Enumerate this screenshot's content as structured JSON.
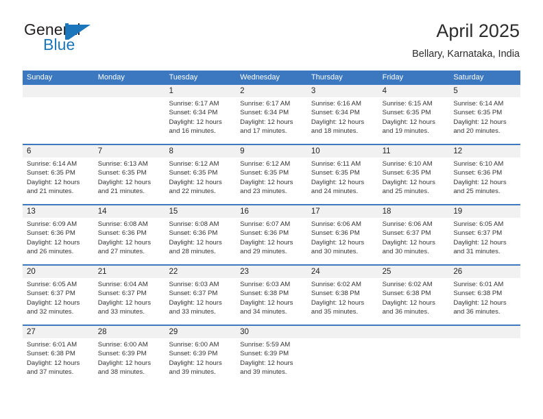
{
  "logo": {
    "word_top": "General",
    "word_bottom": "Blue",
    "mark": "triangle-flag-icon",
    "color": "#1b76bc"
  },
  "header": {
    "title": "April 2025",
    "subtitle": "Bellary, Karnataka, India"
  },
  "colors": {
    "header_blue": "#3b78c0",
    "row_band": "#f1f1f1",
    "text": "#333333"
  },
  "calendar": {
    "weekdays": [
      "Sunday",
      "Monday",
      "Tuesday",
      "Wednesday",
      "Thursday",
      "Friday",
      "Saturday"
    ],
    "weeks": [
      {
        "days": [
          {
            "num": "",
            "sunrise": "",
            "sunset": "",
            "daylight_1": "",
            "daylight_2": ""
          },
          {
            "num": "",
            "sunrise": "",
            "sunset": "",
            "daylight_1": "",
            "daylight_2": ""
          },
          {
            "num": "1",
            "sunrise": "Sunrise: 6:17 AM",
            "sunset": "Sunset: 6:34 PM",
            "daylight_1": "Daylight: 12 hours",
            "daylight_2": "and 16 minutes."
          },
          {
            "num": "2",
            "sunrise": "Sunrise: 6:17 AM",
            "sunset": "Sunset: 6:34 PM",
            "daylight_1": "Daylight: 12 hours",
            "daylight_2": "and 17 minutes."
          },
          {
            "num": "3",
            "sunrise": "Sunrise: 6:16 AM",
            "sunset": "Sunset: 6:34 PM",
            "daylight_1": "Daylight: 12 hours",
            "daylight_2": "and 18 minutes."
          },
          {
            "num": "4",
            "sunrise": "Sunrise: 6:15 AM",
            "sunset": "Sunset: 6:35 PM",
            "daylight_1": "Daylight: 12 hours",
            "daylight_2": "and 19 minutes."
          },
          {
            "num": "5",
            "sunrise": "Sunrise: 6:14 AM",
            "sunset": "Sunset: 6:35 PM",
            "daylight_1": "Daylight: 12 hours",
            "daylight_2": "and 20 minutes."
          }
        ]
      },
      {
        "days": [
          {
            "num": "6",
            "sunrise": "Sunrise: 6:14 AM",
            "sunset": "Sunset: 6:35 PM",
            "daylight_1": "Daylight: 12 hours",
            "daylight_2": "and 21 minutes."
          },
          {
            "num": "7",
            "sunrise": "Sunrise: 6:13 AM",
            "sunset": "Sunset: 6:35 PM",
            "daylight_1": "Daylight: 12 hours",
            "daylight_2": "and 21 minutes."
          },
          {
            "num": "8",
            "sunrise": "Sunrise: 6:12 AM",
            "sunset": "Sunset: 6:35 PM",
            "daylight_1": "Daylight: 12 hours",
            "daylight_2": "and 22 minutes."
          },
          {
            "num": "9",
            "sunrise": "Sunrise: 6:12 AM",
            "sunset": "Sunset: 6:35 PM",
            "daylight_1": "Daylight: 12 hours",
            "daylight_2": "and 23 minutes."
          },
          {
            "num": "10",
            "sunrise": "Sunrise: 6:11 AM",
            "sunset": "Sunset: 6:35 PM",
            "daylight_1": "Daylight: 12 hours",
            "daylight_2": "and 24 minutes."
          },
          {
            "num": "11",
            "sunrise": "Sunrise: 6:10 AM",
            "sunset": "Sunset: 6:35 PM",
            "daylight_1": "Daylight: 12 hours",
            "daylight_2": "and 25 minutes."
          },
          {
            "num": "12",
            "sunrise": "Sunrise: 6:10 AM",
            "sunset": "Sunset: 6:36 PM",
            "daylight_1": "Daylight: 12 hours",
            "daylight_2": "and 25 minutes."
          }
        ]
      },
      {
        "days": [
          {
            "num": "13",
            "sunrise": "Sunrise: 6:09 AM",
            "sunset": "Sunset: 6:36 PM",
            "daylight_1": "Daylight: 12 hours",
            "daylight_2": "and 26 minutes."
          },
          {
            "num": "14",
            "sunrise": "Sunrise: 6:08 AM",
            "sunset": "Sunset: 6:36 PM",
            "daylight_1": "Daylight: 12 hours",
            "daylight_2": "and 27 minutes."
          },
          {
            "num": "15",
            "sunrise": "Sunrise: 6:08 AM",
            "sunset": "Sunset: 6:36 PM",
            "daylight_1": "Daylight: 12 hours",
            "daylight_2": "and 28 minutes."
          },
          {
            "num": "16",
            "sunrise": "Sunrise: 6:07 AM",
            "sunset": "Sunset: 6:36 PM",
            "daylight_1": "Daylight: 12 hours",
            "daylight_2": "and 29 minutes."
          },
          {
            "num": "17",
            "sunrise": "Sunrise: 6:06 AM",
            "sunset": "Sunset: 6:36 PM",
            "daylight_1": "Daylight: 12 hours",
            "daylight_2": "and 30 minutes."
          },
          {
            "num": "18",
            "sunrise": "Sunrise: 6:06 AM",
            "sunset": "Sunset: 6:37 PM",
            "daylight_1": "Daylight: 12 hours",
            "daylight_2": "and 30 minutes."
          },
          {
            "num": "19",
            "sunrise": "Sunrise: 6:05 AM",
            "sunset": "Sunset: 6:37 PM",
            "daylight_1": "Daylight: 12 hours",
            "daylight_2": "and 31 minutes."
          }
        ]
      },
      {
        "days": [
          {
            "num": "20",
            "sunrise": "Sunrise: 6:05 AM",
            "sunset": "Sunset: 6:37 PM",
            "daylight_1": "Daylight: 12 hours",
            "daylight_2": "and 32 minutes."
          },
          {
            "num": "21",
            "sunrise": "Sunrise: 6:04 AM",
            "sunset": "Sunset: 6:37 PM",
            "daylight_1": "Daylight: 12 hours",
            "daylight_2": "and 33 minutes."
          },
          {
            "num": "22",
            "sunrise": "Sunrise: 6:03 AM",
            "sunset": "Sunset: 6:37 PM",
            "daylight_1": "Daylight: 12 hours",
            "daylight_2": "and 33 minutes."
          },
          {
            "num": "23",
            "sunrise": "Sunrise: 6:03 AM",
            "sunset": "Sunset: 6:38 PM",
            "daylight_1": "Daylight: 12 hours",
            "daylight_2": "and 34 minutes."
          },
          {
            "num": "24",
            "sunrise": "Sunrise: 6:02 AM",
            "sunset": "Sunset: 6:38 PM",
            "daylight_1": "Daylight: 12 hours",
            "daylight_2": "and 35 minutes."
          },
          {
            "num": "25",
            "sunrise": "Sunrise: 6:02 AM",
            "sunset": "Sunset: 6:38 PM",
            "daylight_1": "Daylight: 12 hours",
            "daylight_2": "and 36 minutes."
          },
          {
            "num": "26",
            "sunrise": "Sunrise: 6:01 AM",
            "sunset": "Sunset: 6:38 PM",
            "daylight_1": "Daylight: 12 hours",
            "daylight_2": "and 36 minutes."
          }
        ]
      },
      {
        "days": [
          {
            "num": "27",
            "sunrise": "Sunrise: 6:01 AM",
            "sunset": "Sunset: 6:38 PM",
            "daylight_1": "Daylight: 12 hours",
            "daylight_2": "and 37 minutes."
          },
          {
            "num": "28",
            "sunrise": "Sunrise: 6:00 AM",
            "sunset": "Sunset: 6:39 PM",
            "daylight_1": "Daylight: 12 hours",
            "daylight_2": "and 38 minutes."
          },
          {
            "num": "29",
            "sunrise": "Sunrise: 6:00 AM",
            "sunset": "Sunset: 6:39 PM",
            "daylight_1": "Daylight: 12 hours",
            "daylight_2": "and 39 minutes."
          },
          {
            "num": "30",
            "sunrise": "Sunrise: 5:59 AM",
            "sunset": "Sunset: 6:39 PM",
            "daylight_1": "Daylight: 12 hours",
            "daylight_2": "and 39 minutes."
          },
          {
            "num": "",
            "sunrise": "",
            "sunset": "",
            "daylight_1": "",
            "daylight_2": ""
          },
          {
            "num": "",
            "sunrise": "",
            "sunset": "",
            "daylight_1": "",
            "daylight_2": ""
          },
          {
            "num": "",
            "sunrise": "",
            "sunset": "",
            "daylight_1": "",
            "daylight_2": ""
          }
        ]
      }
    ]
  }
}
